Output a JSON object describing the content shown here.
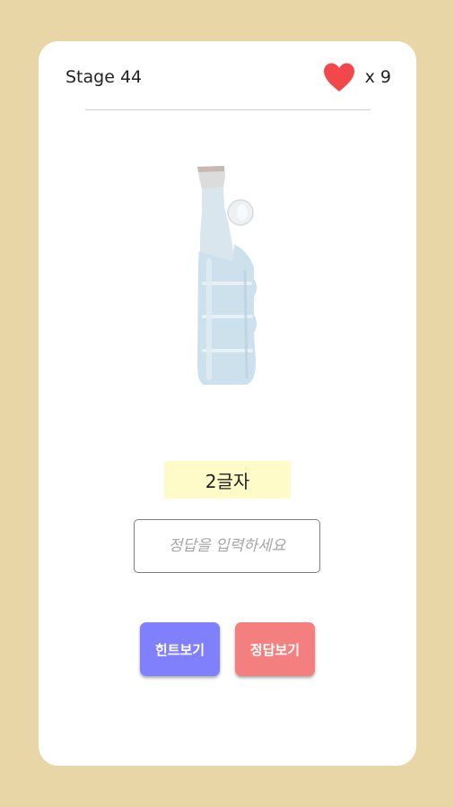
{
  "header": {
    "stage_label": "Stage 44",
    "lives_text": "x 9"
  },
  "icons": {
    "lives": "heart-icon",
    "puzzle_image": "bottle-icon"
  },
  "colors": {
    "background": "#e9d6a6",
    "heart": "#f2484b",
    "hint_badge": "#fffbc8",
    "hint_button": "#8080fc",
    "answer_button": "#f47f7f"
  },
  "hint": {
    "letter_count": "2글자"
  },
  "answer": {
    "placeholder": "정답을 입력하세요",
    "value": ""
  },
  "buttons": {
    "hint_label": "힌트보기",
    "answer_label": "정답보기"
  }
}
